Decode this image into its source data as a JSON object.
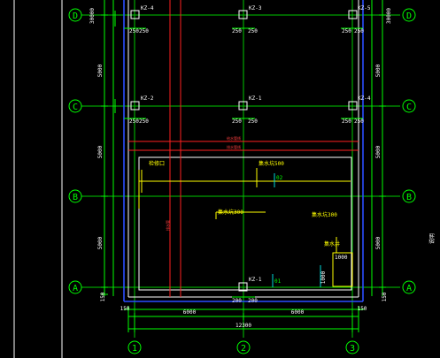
{
  "axes": {
    "rows": [
      "D",
      "C",
      "B",
      "A"
    ],
    "cols": [
      "1",
      "2",
      "3"
    ]
  },
  "dimensions": {
    "row_spacing_left": [
      "5000",
      "5000",
      "5000"
    ],
    "row_spacing_right": [
      "5000",
      "5000",
      "5000"
    ],
    "top_edge": "30000",
    "bottom_edge": "150",
    "col_spacing": [
      "6000",
      "6000"
    ],
    "overall": "12300",
    "bottom_left_edge": "150",
    "bottom_right_edge": "150",
    "column_offset_a": "250",
    "column_offset_b": "200"
  },
  "column_tags": {
    "top": [
      "KZ-4",
      "KZ-3",
      "KZ-5"
    ],
    "mid": [
      "KZ-2",
      "KZ-1",
      "KZ-4"
    ],
    "bottom": "KZ-1"
  },
  "notes": {
    "pipe_top": "给水管线",
    "pipe_bottom": "排水管线",
    "left_tag": "检修口",
    "label_500": "集水坑500",
    "label_02": "02",
    "label_300": "集水坑300",
    "label_pit": "集水坑300",
    "label_pump": "集水井",
    "dim_1000": "1000",
    "dim_1000_v": "1000",
    "label_01": "01",
    "red_vertical": "排水管",
    "side_text": "说明"
  }
}
